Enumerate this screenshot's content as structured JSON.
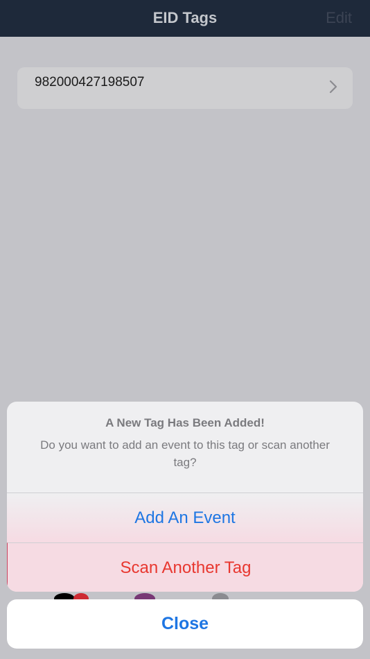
{
  "navbar": {
    "title": "EID Tags",
    "edit_label": "Edit"
  },
  "tags": [
    {
      "id": "982000427198507"
    }
  ],
  "action_sheet": {
    "title": "A New Tag Has Been Added!",
    "message": "Do you want to add an event to this tag or scan another tag?",
    "actions": [
      {
        "label": "Add An Event",
        "color": "#1e76e3"
      },
      {
        "label": "Scan Another Tag",
        "color": "#e8372f"
      }
    ],
    "cancel_label": "Close"
  },
  "colors": {
    "navbar_bg": "#1f2a3c",
    "accent_blue": "#1e76e3",
    "destructive_red": "#e8372f"
  }
}
